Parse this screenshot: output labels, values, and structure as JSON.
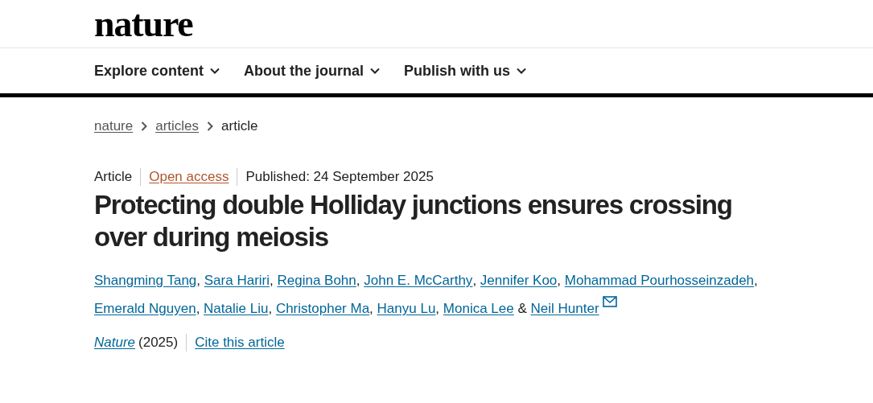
{
  "header": {
    "logo": "nature"
  },
  "nav": [
    {
      "label": "Explore content"
    },
    {
      "label": "About the journal"
    },
    {
      "label": "Publish with us"
    }
  ],
  "breadcrumb": [
    {
      "label": "nature",
      "kind": "link"
    },
    {
      "label": "articles",
      "kind": "link"
    },
    {
      "label": "article",
      "kind": "current"
    }
  ],
  "article": {
    "type": "Article",
    "access": "Open access",
    "published": "Published: 24 September 2025",
    "title": "Protecting double Holliday junctions ensures crossing over during meiosis",
    "authors": [
      {
        "name": "Shangming Tang",
        "sep": ",",
        "contact": false
      },
      {
        "name": "Sara Hariri",
        "sep": ",",
        "contact": false
      },
      {
        "name": "Regina Bohn",
        "sep": ",",
        "contact": false
      },
      {
        "name": "John E. McCarthy",
        "sep": ",",
        "contact": false
      },
      {
        "name": "Jennifer Koo",
        "sep": ",",
        "contact": false
      },
      {
        "name": "Mohammad Pourhosseinzadeh",
        "sep": ",",
        "contact": false
      },
      {
        "name": "Emerald Nguyen",
        "sep": ",",
        "contact": false
      },
      {
        "name": "Natalie Liu",
        "sep": ",",
        "contact": false
      },
      {
        "name": "Christopher Ma",
        "sep": ",",
        "contact": false
      },
      {
        "name": "Hanyu Lu",
        "sep": ",",
        "contact": false
      },
      {
        "name": "Monica Lee",
        "sep": "&",
        "contact": false
      },
      {
        "name": "Neil Hunter",
        "contact": true
      }
    ],
    "journal": "Nature",
    "year": "(2025)",
    "cite": "Cite this article"
  }
}
